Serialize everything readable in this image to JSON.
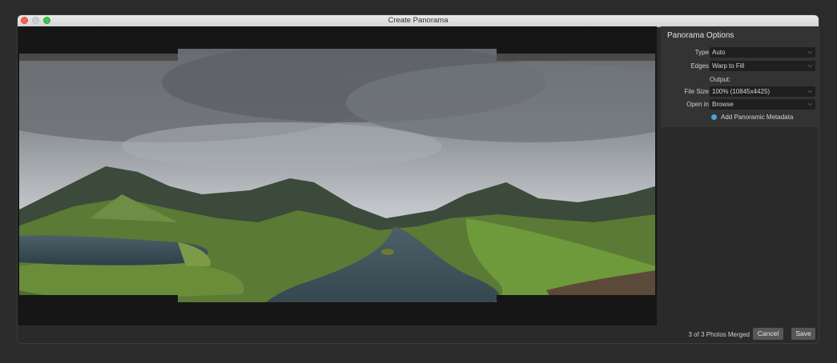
{
  "window": {
    "title": "Create Panorama"
  },
  "panel": {
    "title": "Panorama Options",
    "type_label": "Type",
    "type_value": "Auto",
    "edges_label": "Edges",
    "edges_value": "Warp to Fill",
    "output_label": "Output:",
    "filesize_label": "File Size",
    "filesize_value": "100% (10845x4425)",
    "openin_label": "Open in",
    "openin_value": "Browse",
    "metadata_label": "Add Panoramic Metadata"
  },
  "footer": {
    "status": "3 of 3 Photos Merged",
    "cancel_label": "Cancel",
    "save_label": "Save"
  },
  "colors": {
    "accent": "#4aa3d8",
    "close": "#fc5f57",
    "maximize": "#35c84a"
  }
}
